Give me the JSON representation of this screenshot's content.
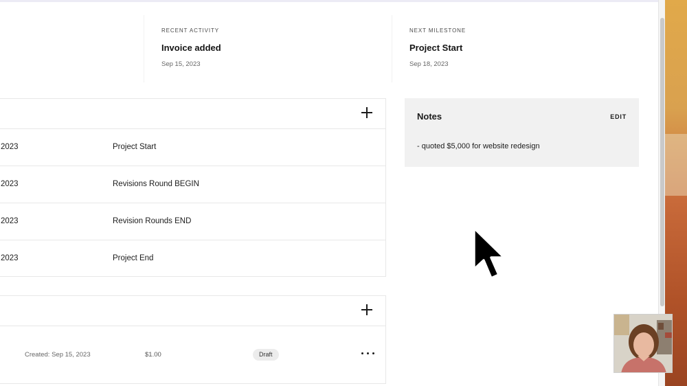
{
  "summary": {
    "recent_activity": {
      "label": "RECENT ACTIVITY",
      "title": "Invoice added",
      "date": "Sep 15, 2023"
    },
    "next_milestone": {
      "label": "NEXT MILESTONE",
      "title": "Project Start",
      "date": "Sep 18, 2023"
    }
  },
  "milestones": {
    "add_icon": "plus-icon",
    "rows": [
      {
        "date": "2023",
        "name": "Project Start"
      },
      {
        "date": "2023",
        "name": "Revisions Round BEGIN"
      },
      {
        "date": "2023",
        "name": "Revision Rounds END"
      },
      {
        "date": "2023",
        "name": "Project End"
      }
    ]
  },
  "invoices": {
    "add_icon": "plus-icon",
    "rows": [
      {
        "created": "Created: Sep 15, 2023",
        "amount": "$1.00",
        "status": "Draft",
        "more_icon": "more-horizontal-icon"
      }
    ]
  },
  "notes": {
    "title": "Notes",
    "edit_label": "EDIT",
    "body": "- quoted $5,000 for website redesign"
  },
  "colors": {
    "panel_border": "#e7e7e7",
    "notes_background": "#f1f1f1",
    "status_badge_background": "#ececec",
    "text_primary": "#1b1b1b",
    "text_secondary": "#666666"
  }
}
